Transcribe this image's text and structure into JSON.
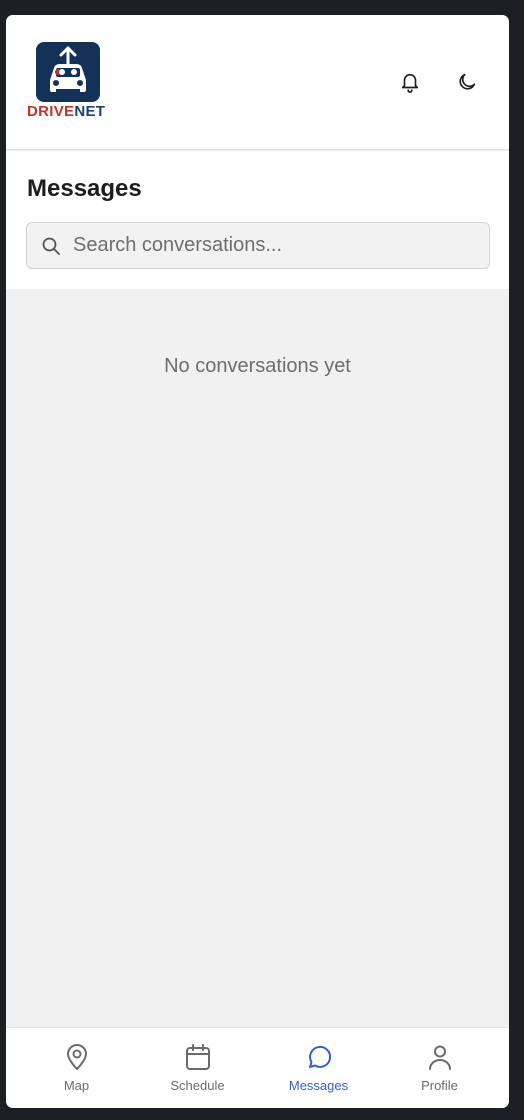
{
  "brand": {
    "part1": "DRIVE",
    "part2": "NET"
  },
  "header": {
    "title": "Messages"
  },
  "search": {
    "placeholder": "Search conversations..."
  },
  "empty_state": "No conversations yet",
  "tabs": [
    {
      "label": "Map",
      "icon": "map-pin-icon"
    },
    {
      "label": "Schedule",
      "icon": "calendar-icon"
    },
    {
      "label": "Messages",
      "icon": "chat-bubble-icon",
      "active": true
    },
    {
      "label": "Profile",
      "icon": "user-icon"
    }
  ],
  "colors": {
    "accent": "#2f5fd6",
    "brand_red": "#c3332b",
    "brand_navy": "#14315a"
  }
}
